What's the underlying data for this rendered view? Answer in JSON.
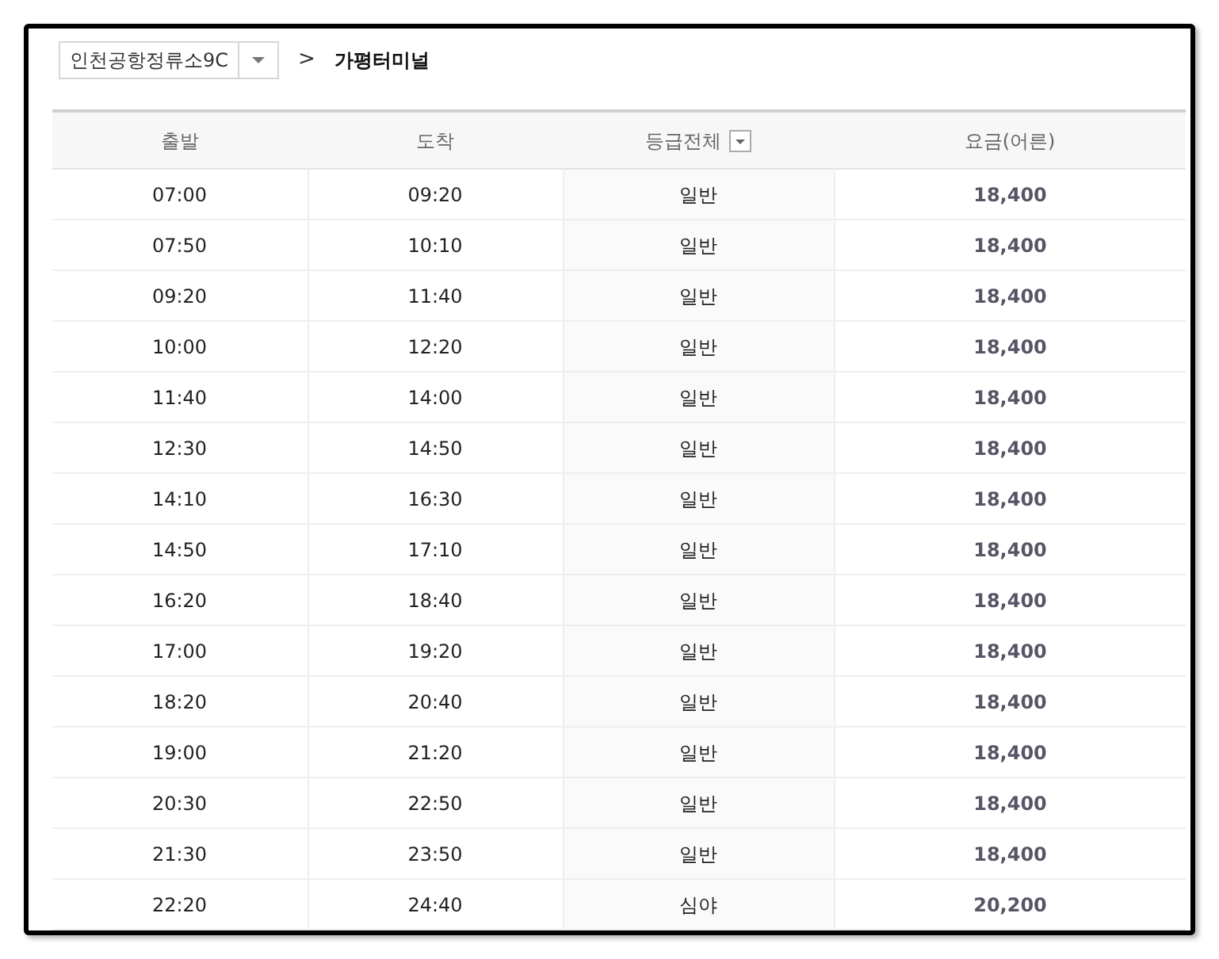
{
  "route": {
    "origin": "인천공항정류소9C",
    "separator": ">",
    "destination": "가평터미널"
  },
  "table": {
    "columns": [
      {
        "label": "출발",
        "filter": false
      },
      {
        "label": "도착",
        "filter": false
      },
      {
        "label": "등급전체",
        "filter": true
      },
      {
        "label": "요금(어른)",
        "filter": false
      }
    ],
    "rows": [
      {
        "departure": "07:00",
        "arrival": "09:20",
        "grade": "일반",
        "fare": "18,400"
      },
      {
        "departure": "07:50",
        "arrival": "10:10",
        "grade": "일반",
        "fare": "18,400"
      },
      {
        "departure": "09:20",
        "arrival": "11:40",
        "grade": "일반",
        "fare": "18,400"
      },
      {
        "departure": "10:00",
        "arrival": "12:20",
        "grade": "일반",
        "fare": "18,400"
      },
      {
        "departure": "11:40",
        "arrival": "14:00",
        "grade": "일반",
        "fare": "18,400"
      },
      {
        "departure": "12:30",
        "arrival": "14:50",
        "grade": "일반",
        "fare": "18,400"
      },
      {
        "departure": "14:10",
        "arrival": "16:30",
        "grade": "일반",
        "fare": "18,400"
      },
      {
        "departure": "14:50",
        "arrival": "17:10",
        "grade": "일반",
        "fare": "18,400"
      },
      {
        "departure": "16:20",
        "arrival": "18:40",
        "grade": "일반",
        "fare": "18,400"
      },
      {
        "departure": "17:00",
        "arrival": "19:20",
        "grade": "일반",
        "fare": "18,400"
      },
      {
        "departure": "18:20",
        "arrival": "20:40",
        "grade": "일반",
        "fare": "18,400"
      },
      {
        "departure": "19:00",
        "arrival": "21:20",
        "grade": "일반",
        "fare": "18,400"
      },
      {
        "departure": "20:30",
        "arrival": "22:50",
        "grade": "일반",
        "fare": "18,400"
      },
      {
        "departure": "21:30",
        "arrival": "23:50",
        "grade": "일반",
        "fare": "18,400"
      },
      {
        "departure": "22:20",
        "arrival": "24:40",
        "grade": "심야",
        "fare": "20,200"
      }
    ]
  }
}
